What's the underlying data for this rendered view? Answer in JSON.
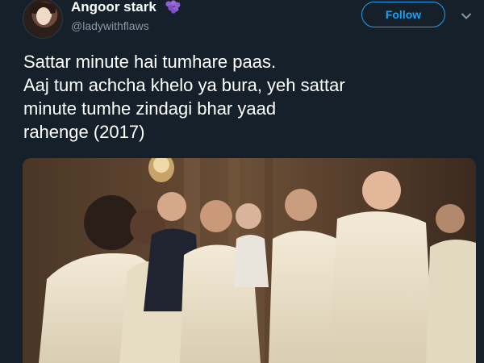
{
  "user": {
    "display_name": "Angoor stark",
    "handle": "@ladywithflaws",
    "name_emoji_icon": "grapes-icon"
  },
  "follow_button": {
    "label": "Follow"
  },
  "caret_icon": "chevron-down-icon",
  "tweet": {
    "lines": [
      "Sattar minute hai tumhare paas.",
      "Aaj tum achcha khelo ya bura, yeh sattar",
      "minute tumhe zindagi bhar yaad",
      "rahenge (2017)"
    ]
  },
  "colors": {
    "background": "#15202b",
    "accent": "#1da1f2",
    "secondary_text": "#8899a6"
  }
}
